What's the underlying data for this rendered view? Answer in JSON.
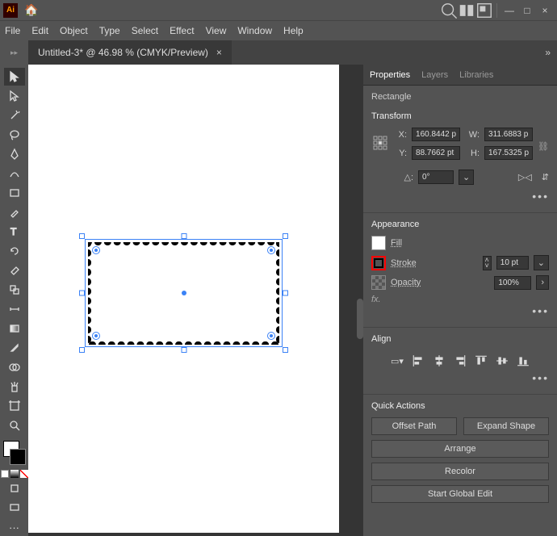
{
  "titlebar": {
    "logo": "Ai"
  },
  "menu": {
    "file": "File",
    "edit": "Edit",
    "object": "Object",
    "type": "Type",
    "select": "Select",
    "effect": "Effect",
    "view": "View",
    "window": "Window",
    "help": "Help"
  },
  "doc": {
    "tab_label": "Untitled-3* @ 46.98 % (CMYK/Preview)",
    "close": "×"
  },
  "panel": {
    "tabs": {
      "properties": "Properties",
      "layers": "Layers",
      "libraries": "Libraries"
    },
    "object_type": "Rectangle",
    "transform": {
      "heading": "Transform",
      "x_label": "X:",
      "x": "160.8442 p",
      "y_label": "Y:",
      "y": "88.7662 pt",
      "w_label": "W:",
      "w": "311.6883 p",
      "h_label": "H:",
      "h": "167.5325 p",
      "angle_label": "△:",
      "angle": "0°"
    },
    "appearance": {
      "heading": "Appearance",
      "fill_label": "Fill",
      "stroke_label": "Stroke",
      "stroke_weight": "10 pt",
      "opacity_label": "Opacity",
      "opacity": "100%",
      "fx": "fx."
    },
    "align": {
      "heading": "Align"
    },
    "quick": {
      "heading": "Quick Actions",
      "offset": "Offset Path",
      "expand": "Expand Shape",
      "arrange": "Arrange",
      "recolor": "Recolor",
      "global": "Start Global Edit"
    }
  }
}
